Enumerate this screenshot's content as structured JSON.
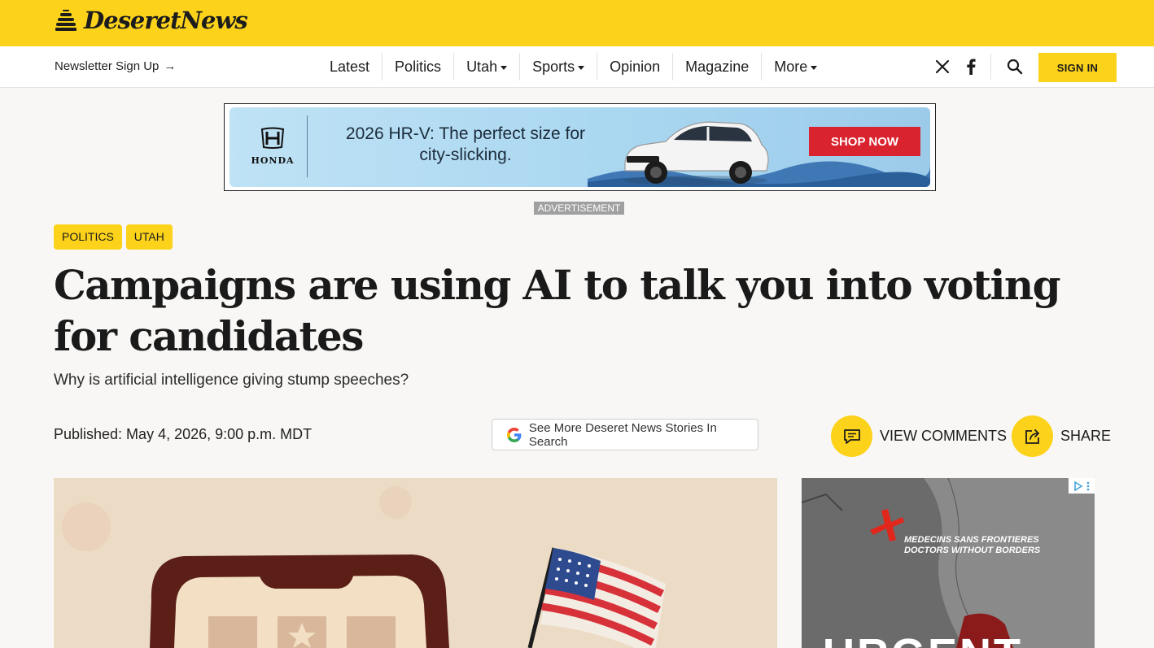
{
  "brand": {
    "name": "DeseretNews",
    "color": "#fcd21b"
  },
  "nav": {
    "newsletter_label": "Newsletter Sign Up",
    "newsletter_arrow": "→",
    "links": [
      {
        "label": "Latest",
        "dropdown": false
      },
      {
        "label": "Politics",
        "dropdown": false
      },
      {
        "label": "Utah",
        "dropdown": true
      },
      {
        "label": "Sports",
        "dropdown": true
      },
      {
        "label": "Opinion",
        "dropdown": false
      },
      {
        "label": "Magazine",
        "dropdown": false
      },
      {
        "label": "More",
        "dropdown": true
      }
    ],
    "social_icons": [
      "x-icon",
      "facebook-icon"
    ],
    "search_icon": "search-icon",
    "signin_label": "SIGN IN"
  },
  "ad_banner": {
    "brand": "HONDA",
    "headline_line1": "2026 HR-V: The perfect size for",
    "headline_line2": "city-slicking.",
    "cta": "SHOP NOW",
    "label": "ADVERTISEMENT"
  },
  "article": {
    "tags": [
      "POLITICS",
      "UTAH"
    ],
    "headline": "Campaigns are using AI to talk you into voting for candidates",
    "subheadline": "Why is artificial intelligence giving stump speeches?",
    "published": "Published: May 4, 2026, 9:00 p.m. MDT",
    "google_button": "See More Deseret News Stories In Search",
    "comments_label": "VIEW COMMENTS",
    "share_label": "SHARE"
  },
  "side_ad": {
    "org_line1": "MEDECINS SANS FRONTIERES",
    "org_line2": "DOCTORS WITHOUT BORDERS",
    "headline": "URGENT"
  }
}
